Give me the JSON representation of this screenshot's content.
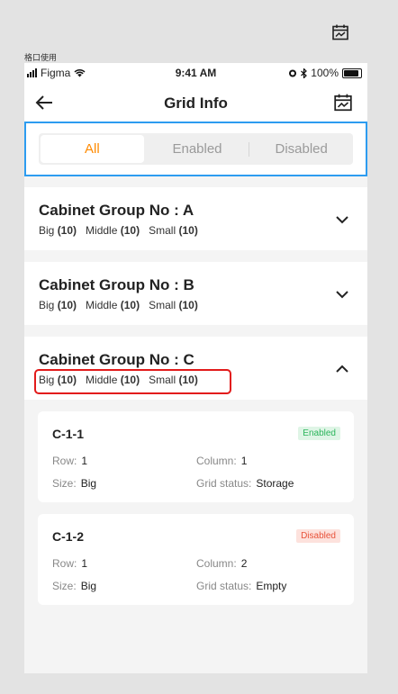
{
  "frame_label": "格口使用",
  "status_bar": {
    "carrier": "Figma",
    "time": "9:41 AM",
    "battery": "100%"
  },
  "navbar": {
    "title": "Grid Info"
  },
  "tabs": [
    {
      "label": "All",
      "active": true
    },
    {
      "label": "Enabled",
      "active": false
    },
    {
      "label": "Disabled",
      "active": false
    }
  ],
  "groups": [
    {
      "name": "Cabinet Group No : A",
      "big_label": "Big",
      "big": "(10)",
      "middle_label": "Middle",
      "middle": "(10)",
      "small_label": "Small",
      "small": "(10)",
      "expanded": false
    },
    {
      "name": "Cabinet Group No : B",
      "big_label": "Big",
      "big": "(10)",
      "middle_label": "Middle",
      "middle": "(10)",
      "small_label": "Small",
      "small": "(10)",
      "expanded": false
    },
    {
      "name": "Cabinet Group No : C",
      "big_label": "Big",
      "big": "(10)",
      "middle_label": "Middle",
      "middle": "(10)",
      "small_label": "Small",
      "small": "(10)",
      "expanded": true
    }
  ],
  "cells": [
    {
      "id": "C-1-1",
      "status": "Enabled",
      "row_label": "Row:",
      "row": "1",
      "col_label": "Column:",
      "col": "1",
      "size_label": "Size:",
      "size": "Big",
      "grid_label": "Grid status:",
      "grid_status": "Storage"
    },
    {
      "id": "C-1-2",
      "status": "Disabled",
      "row_label": "Row:",
      "row": "1",
      "col_label": "Column:",
      "col": "2",
      "size_label": "Size:",
      "size": "Big",
      "grid_label": "Grid status:",
      "grid_status": "Empty"
    }
  ],
  "colors": {
    "accent": "#ff8a00",
    "highlight_blue": "#2d9cf0",
    "highlight_red": "#e21b1b",
    "enabled": "#2bb55b",
    "disabled": "#e8523a"
  }
}
